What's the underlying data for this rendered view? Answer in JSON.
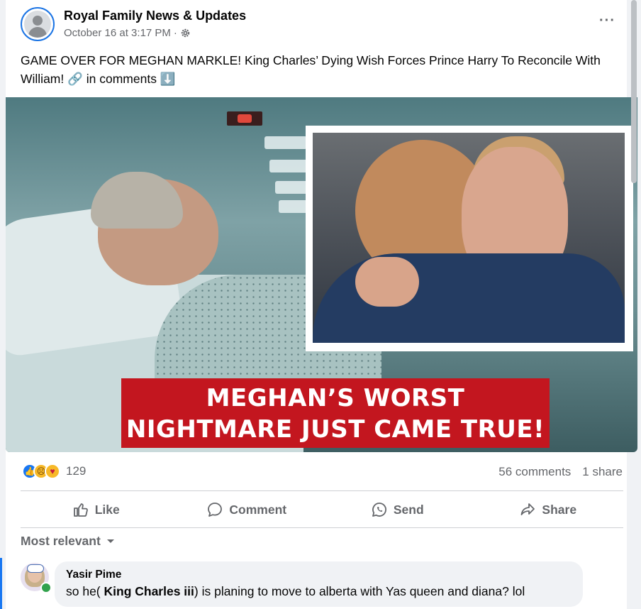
{
  "post": {
    "page_name": "Royal Family News & Updates",
    "timestamp": "October 16 at 3:17 PM",
    "separator": "·",
    "more_icon": "···",
    "text": "GAME OVER FOR MEGHAN MARKLE! King Charles’ Dying Wish Forces Prince Harry To Reconcile With William! 🔗 in comments ⬇️",
    "image": {
      "banner_line1": "MEGHAN’S WORST",
      "banner_line2": "NIGHTMARE JUST CAME TRUE!"
    }
  },
  "stats": {
    "reaction_count": "129",
    "comments": "56 comments",
    "shares": "1 share",
    "reaction_icons": [
      "like-icon",
      "sad-icon",
      "care-icon"
    ]
  },
  "actions": {
    "like": "Like",
    "comment": "Comment",
    "send": "Send",
    "share": "Share"
  },
  "comments": {
    "sort_label": "Most relevant",
    "items": [
      {
        "author": "Yasir Pime",
        "text_before": "so he( ",
        "mention": "King Charles iii",
        "text_after": ") is planing to move to alberta with Yas queen and diana? lol"
      }
    ]
  },
  "colors": {
    "brand": "#1877f2",
    "banner": "#c3161f",
    "online": "#31a24c"
  }
}
